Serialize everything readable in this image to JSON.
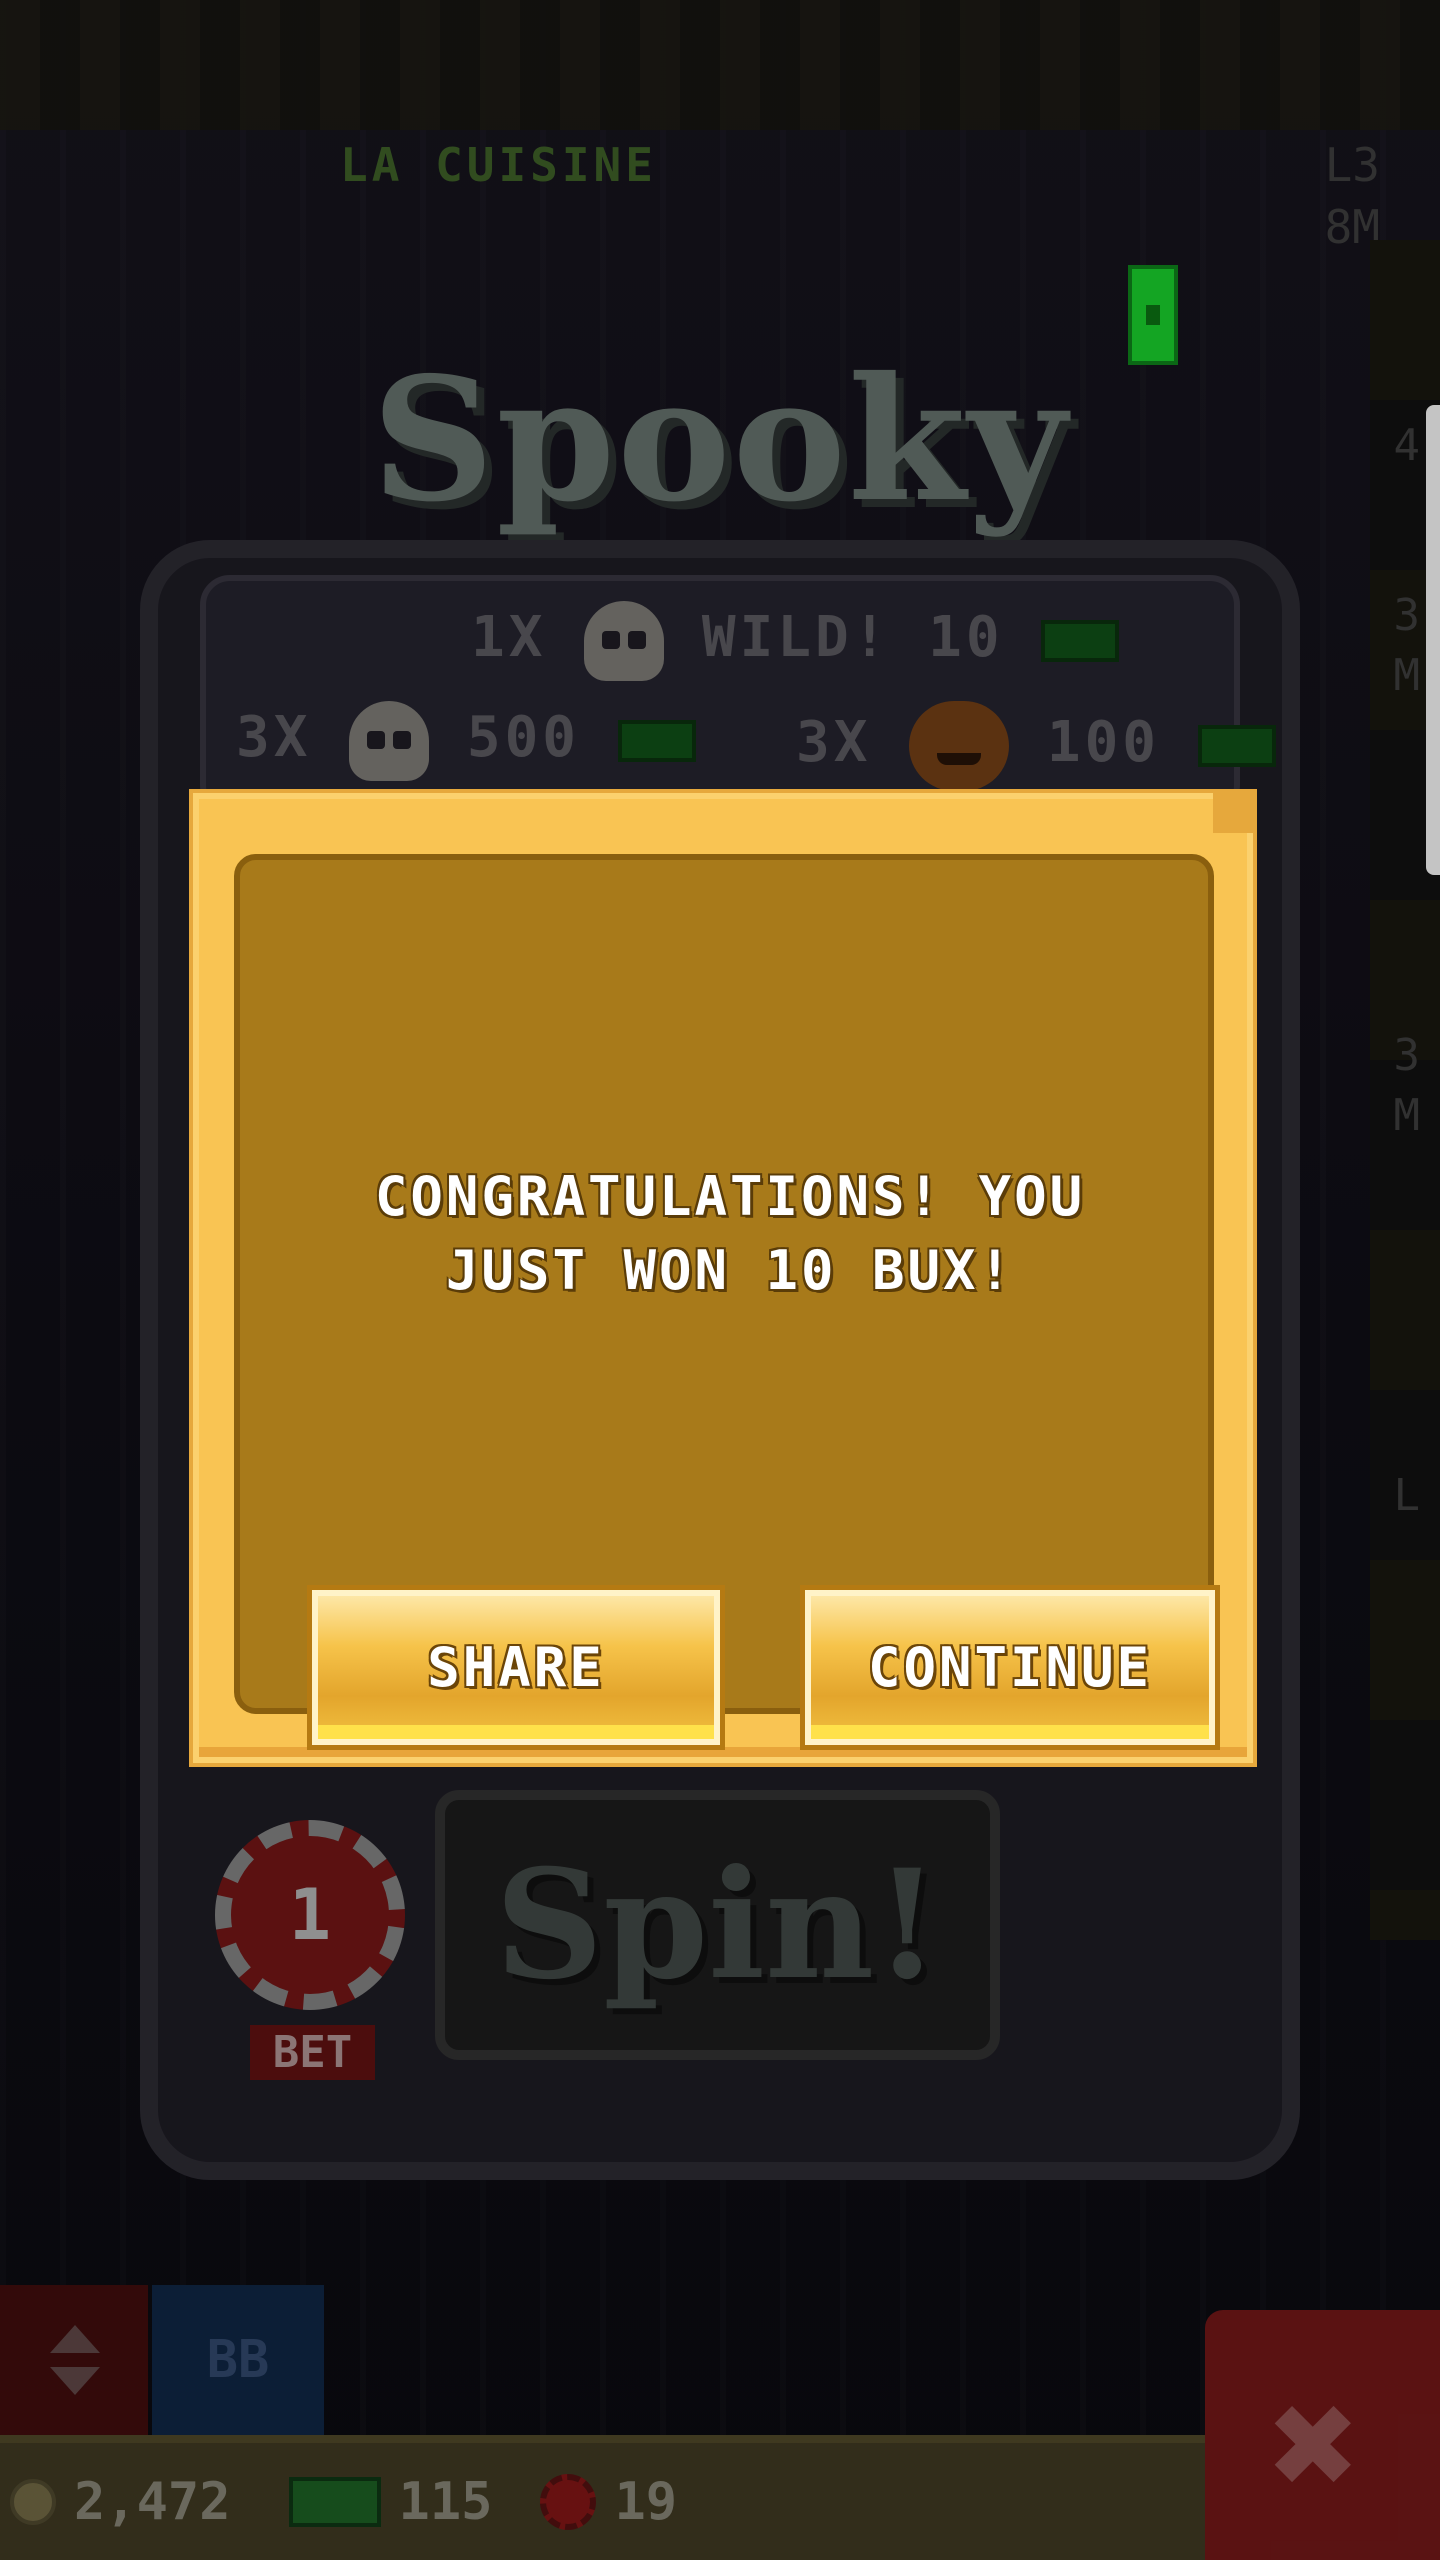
{
  "background": {
    "floor_name": "LA CUISINE",
    "floor_level": "L3",
    "floor_money": "8M",
    "side_labels": [
      "4",
      "3",
      "M",
      "3",
      "M",
      "L"
    ],
    "slot_title": "Spooky Slots",
    "paytable": [
      {
        "count": "1X",
        "symbol": "skull-icon",
        "label": "WILD! 10"
      },
      {
        "count": "3X",
        "symbol": "skull-icon",
        "label": "500"
      },
      {
        "count": "3X",
        "symbol": "pumpkin-icon",
        "label": "100"
      }
    ],
    "bet_value": "1",
    "bet_label": "BET",
    "spin_label": "Spin!",
    "blue_button_label": "BB",
    "close_label": "✖"
  },
  "status_bar": {
    "coins": "2,472",
    "bux": "115",
    "gems": "19"
  },
  "dialog": {
    "message": "CONGRATULATIONS! YOU JUST WON 10 BUX!",
    "share_label": "SHARE",
    "continue_label": "CONTINUE"
  },
  "colors": {
    "dialog_outer": "#f9c453",
    "dialog_inner": "#a87a1a",
    "button_gold": "#f6c34a",
    "bux_green": "#18c22a"
  }
}
